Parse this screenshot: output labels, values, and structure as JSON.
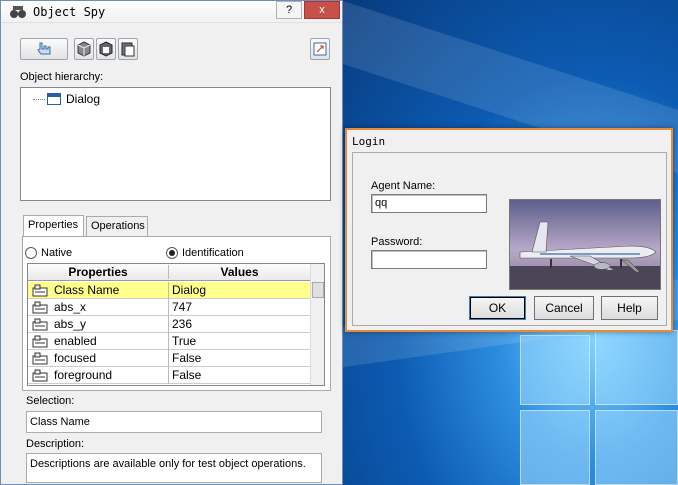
{
  "spy": {
    "title": "Object Spy",
    "help_caption": "?",
    "close_caption": "x",
    "hierarchy_label": "Object hierarchy:",
    "tree_node": "Dialog",
    "tabs": [
      {
        "label": "Properties",
        "active": true
      },
      {
        "label": "Operations",
        "active": false
      }
    ],
    "radios": [
      {
        "label": "Native",
        "selected": false
      },
      {
        "label": "Identification",
        "selected": true
      }
    ],
    "grid": {
      "columns": [
        "Properties",
        "Values"
      ],
      "rows": [
        {
          "name": "Class Name",
          "value": "Dialog",
          "selected": true
        },
        {
          "name": "abs_x",
          "value": "747"
        },
        {
          "name": "abs_y",
          "value": "236"
        },
        {
          "name": "enabled",
          "value": "True"
        },
        {
          "name": "focused",
          "value": "False"
        },
        {
          "name": "foreground",
          "value": "False"
        }
      ]
    },
    "selection_label": "Selection:",
    "selection_value": "Class Name",
    "description_label": "Description:",
    "description_value": "Descriptions are available only for test object operations."
  },
  "login": {
    "title": "Login",
    "agent_label": "Agent Name:",
    "agent_value": "qq",
    "password_label": "Password:",
    "password_value": "",
    "ok": "OK",
    "cancel": "Cancel",
    "help": "Help"
  },
  "icons": [
    "spy-glasses-icon",
    "hand-pointer-icon",
    "object-cube-icon",
    "object-cube-plus-icon",
    "object-cube-doc-icon",
    "pin-window-icon",
    "dialog-node-icon",
    "property-icon",
    "airplane-image"
  ],
  "colors": {
    "selected_row": "#ffff8c",
    "login_border": "#e28c3c",
    "desktop": "#0c5bb2"
  }
}
